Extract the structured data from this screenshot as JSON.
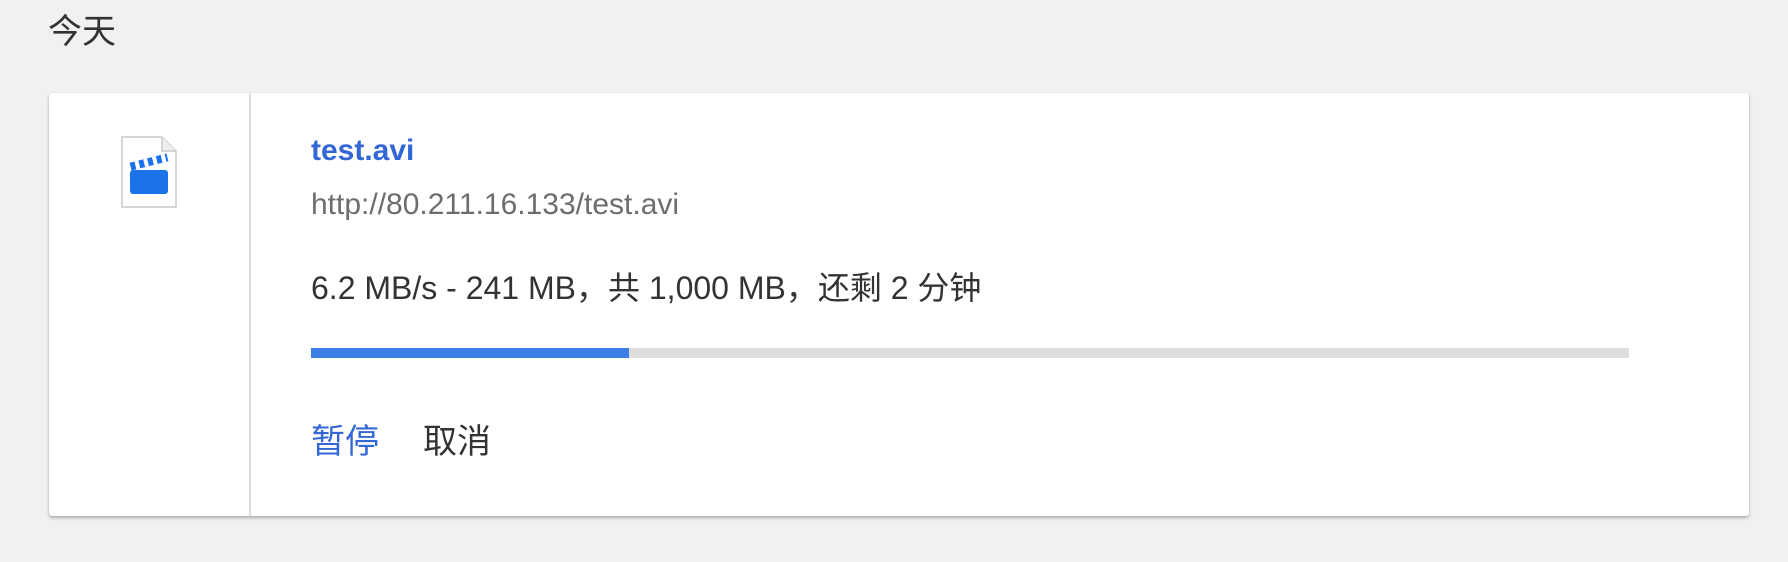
{
  "section": {
    "title": "今天"
  },
  "download": {
    "file_name": "test.avi",
    "url": "http://80.211.16.133/test.avi",
    "status": "6.2 MB/s - 241 MB，共 1,000 MB，还剩 2 分钟",
    "progress_fraction": 0.241,
    "icon": "video-file-icon",
    "actions": {
      "pause_label": "暂停",
      "cancel_label": "取消"
    }
  },
  "colors": {
    "accent": "#3367d6",
    "progress_fill": "#3b7ee6",
    "progress_track": "#dddddd",
    "background": "#f1f1f1"
  }
}
